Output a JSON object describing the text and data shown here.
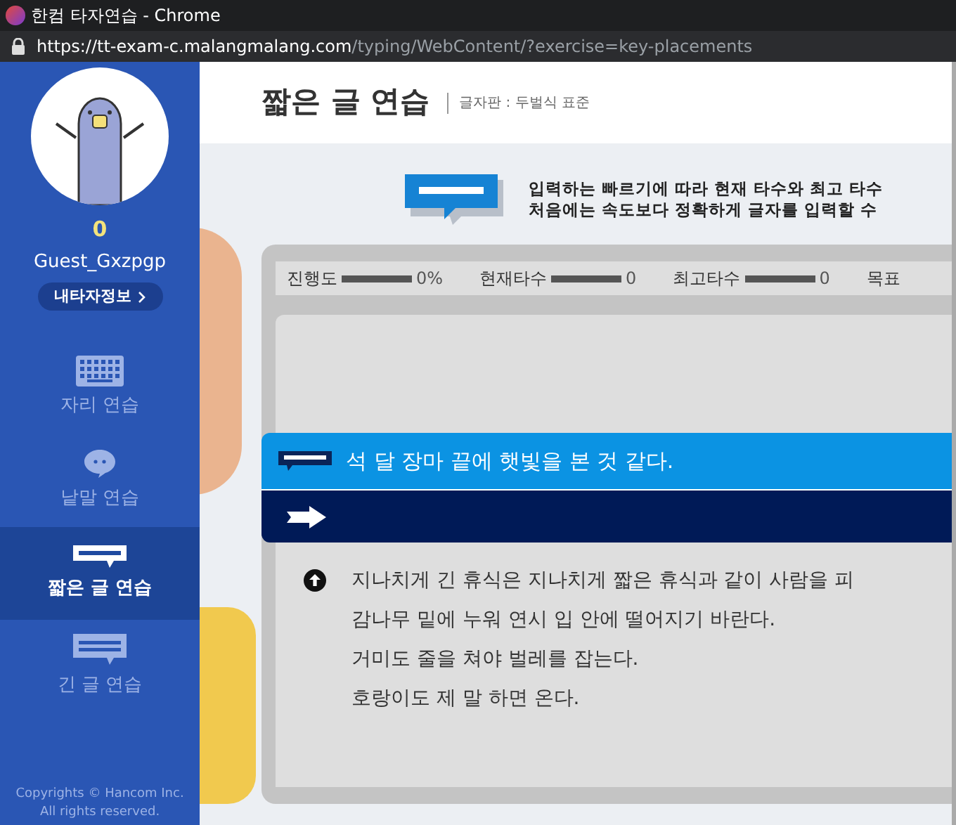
{
  "window": {
    "title": "한컴 타자연습 - Chrome"
  },
  "address_bar": {
    "host": "https://tt-exam-c.malangmalang.com",
    "path": "/typing/WebContent/?exercise=key-placements"
  },
  "profile": {
    "score": "0",
    "username": "Guest_Gxzpgp",
    "info_button": "내타자정보"
  },
  "sidebar": {
    "items": [
      {
        "label": "자리 연습",
        "kind": "keyboard",
        "selected": false
      },
      {
        "label": "낱말 연습",
        "kind": "word",
        "selected": false
      },
      {
        "label": "짧은 글 연습",
        "kind": "short",
        "selected": true
      },
      {
        "label": "긴 글 연습",
        "kind": "long",
        "selected": false
      }
    ],
    "copyright": [
      "Copyrights © Hancom Inc.",
      "All rights reserved."
    ]
  },
  "header": {
    "title": "짧은 글 연습",
    "keyboard_layout": "글자판 : 두벌식 표준"
  },
  "info": {
    "lines": [
      "입력하는 빠르기에 따라 현재 타수와 최고 타수",
      "처음에는 속도보다 정확하게 글자를 입력할 수"
    ]
  },
  "stats": [
    {
      "label": "진행도",
      "value": "0%"
    },
    {
      "label": "현재타수",
      "value": "0"
    },
    {
      "label": "최고타수",
      "value": "0"
    },
    {
      "label": "목표"
    }
  ],
  "current_sentence": "석 달 장마 끝에 햇빛을 본 것 같다.",
  "upcoming": [
    "지나치게 긴 휴식은 지나치게 짧은 휴식과 같이 사람을 피",
    "감나무 밑에 누워 연시 입 안에 떨어지기 바란다.",
    "거미도 줄을 쳐야 벌레를 잡는다.",
    "호랑이도 제 말 하면 온다."
  ]
}
